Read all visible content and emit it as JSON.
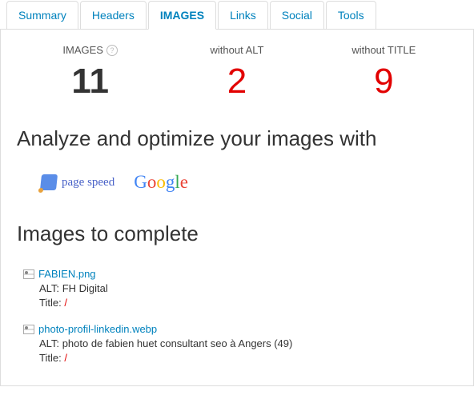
{
  "tabs": {
    "summary": "Summary",
    "headers": "Headers",
    "images": "IMAGES",
    "links": "Links",
    "social": "Social",
    "tools": "Tools"
  },
  "stats": {
    "total_label": "IMAGES",
    "total_value": "11",
    "alt_label": "without ALT",
    "alt_value": "2",
    "title_label": "without TITLE",
    "title_value": "9"
  },
  "optimize_heading": "Analyze and optimize your images with",
  "partners": {
    "pagespeed": "page speed",
    "google": {
      "g1": "G",
      "o1": "o",
      "o2": "o",
      "g2": "g",
      "l": "l",
      "e": "e"
    }
  },
  "list_heading": "Images to complete",
  "labels": {
    "alt": "ALT:",
    "title": "Title:",
    "missing": "/"
  },
  "images": [
    {
      "name": "FABIEN.png",
      "alt": "FH Digital",
      "title": null
    },
    {
      "name": "photo-profil-linkedin.webp",
      "alt": "photo de fabien huet consultant seo à Angers (49)",
      "title": null
    }
  ]
}
